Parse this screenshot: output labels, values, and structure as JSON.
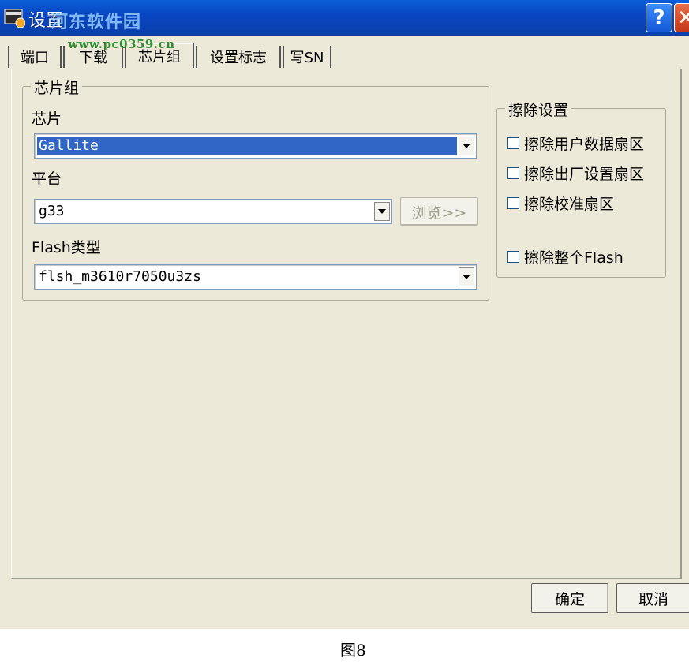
{
  "window": {
    "title": "设置",
    "watermark": "河东软件园",
    "watermark_url": "www.pc0359.cn"
  },
  "tabs": [
    {
      "label": "端口"
    },
    {
      "label": "下载"
    },
    {
      "label": "芯片组",
      "active": true
    },
    {
      "label": "设置标志"
    },
    {
      "label": "写SN"
    }
  ],
  "chipset_group": {
    "legend": "芯片组",
    "chip_label": "芯片",
    "chip_value": "Gallite",
    "platform_label": "平台",
    "platform_value": "g33",
    "browse_label": "浏览>>",
    "flash_label": "Flash类型",
    "flash_value": "flsh_m3610r7050u3zs"
  },
  "erase_group": {
    "legend": "擦除设置",
    "options": [
      {
        "label": "擦除用户数据扇区",
        "checked": false
      },
      {
        "label": "擦除出厂设置扇区",
        "checked": false
      },
      {
        "label": "擦除校准扇区",
        "checked": false
      },
      {
        "label": "擦除整个Flash",
        "checked": false
      }
    ]
  },
  "footer": {
    "ok_label": "确定",
    "cancel_label": "取消"
  },
  "caption": "图8",
  "colors": {
    "titlebar": "#0a4fc8",
    "selection": "#3166c6",
    "dialog_bg": "#ece9d8"
  }
}
